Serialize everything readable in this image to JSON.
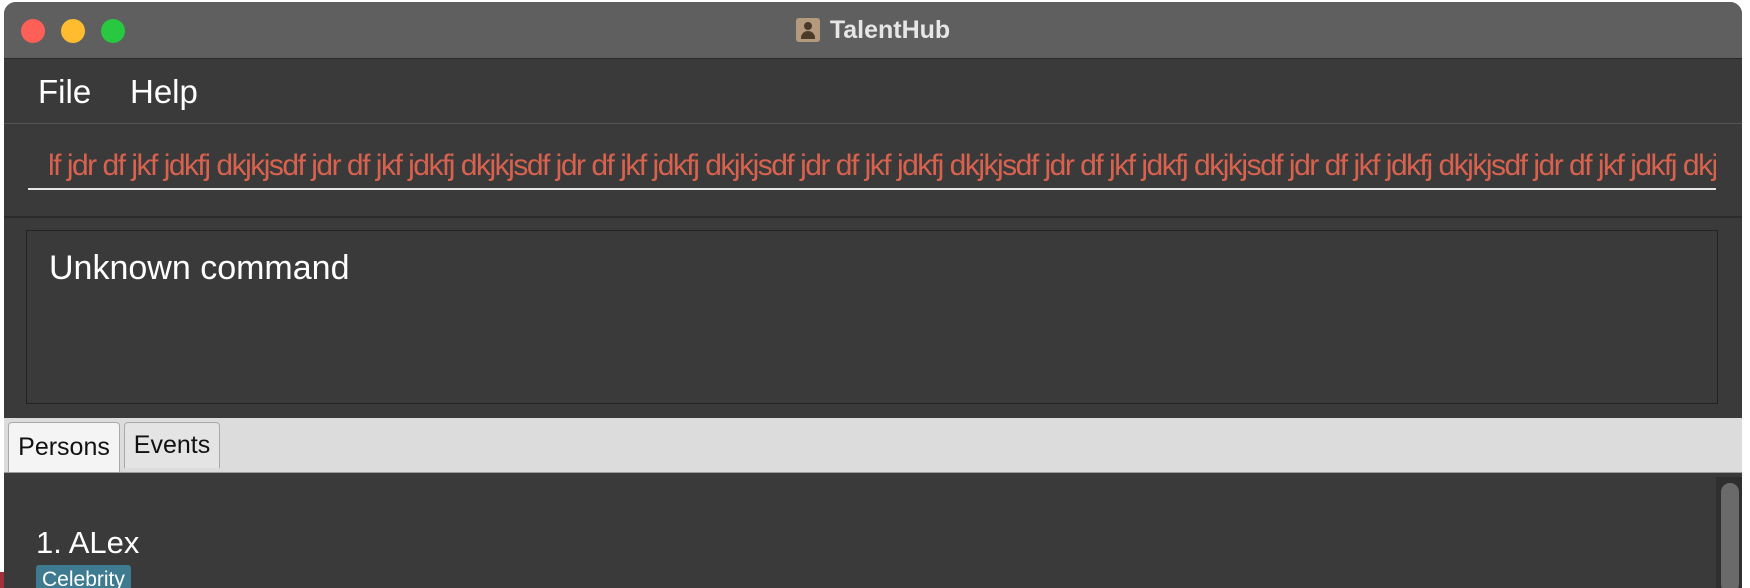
{
  "window": {
    "title": "TalentHub"
  },
  "menu": {
    "file": "File",
    "help": "Help"
  },
  "command": {
    "value": "lf jdr df jkf jdkfj dkjkjsdf jdr df jkf jdkfj dkjkjsdf jdr df jkf jdkfj dkjkjsdf jdr df jkf jdkfj dkjkjsdf jdr df jkf jdkfj dkjkjsdf jdr df jkf jdkfj dkjkjsdf jdr df jkf jdkfj dkjk"
  },
  "result": {
    "message": "Unknown command"
  },
  "tabs": [
    {
      "label": "Persons",
      "selected": true
    },
    {
      "label": "Events",
      "selected": false
    }
  ],
  "persons": [
    {
      "index_name": "1. ALex",
      "tags": [
        "Celebrity"
      ]
    }
  ],
  "colors": {
    "command_error_text": "#d9624f",
    "tag_background": "#3e7b91"
  }
}
